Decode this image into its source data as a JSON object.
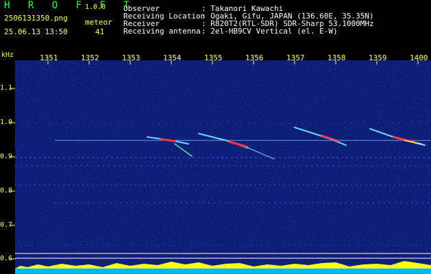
{
  "app": {
    "logo": "H R O F F T",
    "version": "1.0.0",
    "filename": "2506131350.png",
    "datetime": "25.06.13 13:50",
    "meteor_label": "meteor",
    "meteor_count": "41"
  },
  "info": {
    "labels": [
      "Observer",
      "Receiving Location",
      "Receiver",
      "Receiving antenna"
    ],
    "values": [
      ": Takanori Kawachi",
      ": Ogaki, Gifu, JAPAN (136.60E, 35.35N)",
      ": R820T2(RTL-SDR) SDR-Sharp 53.1000MHz",
      ": 2el-HB9CV Vertical (el. E-W)"
    ]
  },
  "axis": {
    "unit": "kHz",
    "x_ticks": [
      "1351",
      "1352",
      "1353",
      "1354",
      "1355",
      "1356",
      "1357",
      "1358",
      "1359",
      "1400"
    ],
    "y_ticks": [
      "1.1",
      "1.0",
      "0.9",
      "0.8",
      "0.7",
      "0.6"
    ]
  },
  "colors": {
    "background": "#000000",
    "plot_bg": "#0a1a78",
    "label_yellow": "#ffff55",
    "logo_green": "#33ff33",
    "meteor_red": "#ff3344",
    "signal_cyan": "#66ddff"
  }
}
